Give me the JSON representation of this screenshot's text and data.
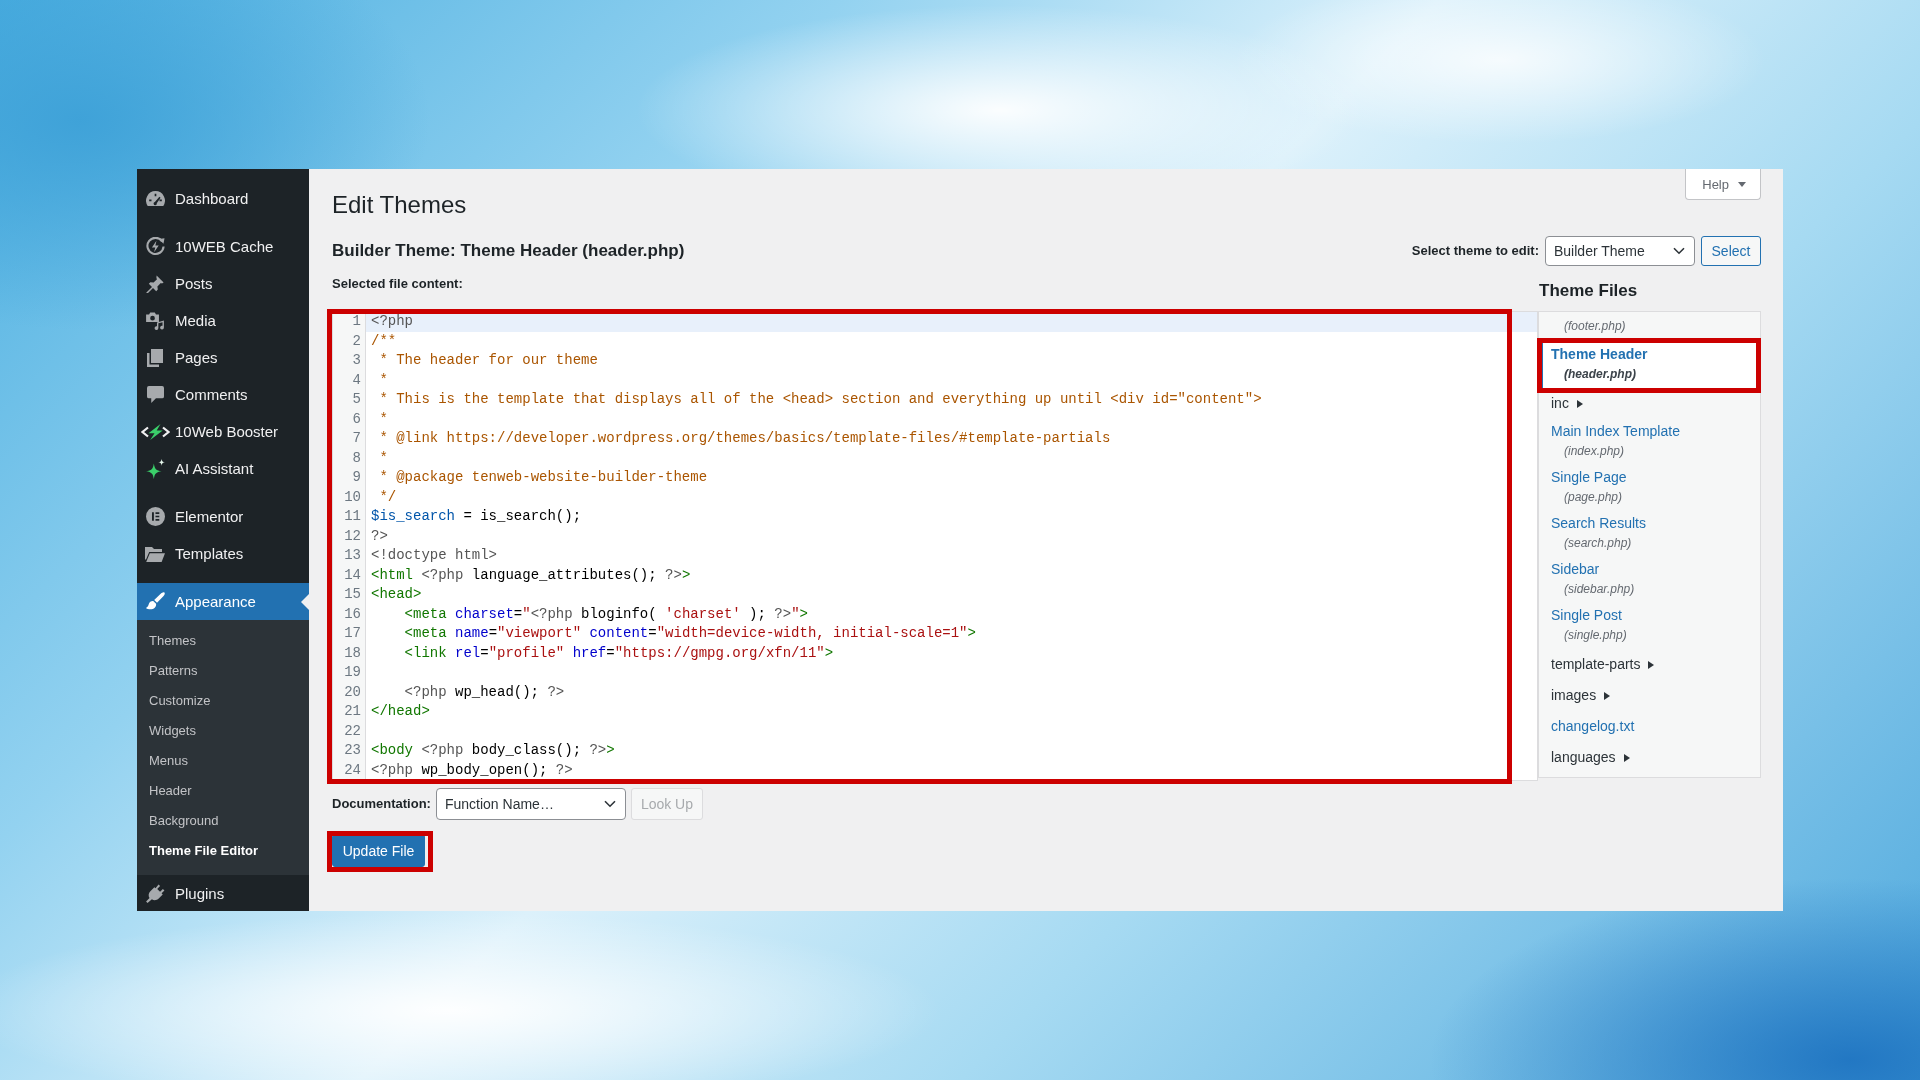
{
  "sidebar": {
    "groups": [
      {
        "items": [
          {
            "label": "Dashboard",
            "selected": false
          }
        ]
      },
      {
        "items": [
          {
            "label": "10WEB Cache",
            "selected": false
          },
          {
            "label": "Posts",
            "selected": false
          },
          {
            "label": "Media",
            "selected": false
          },
          {
            "label": "Pages",
            "selected": false
          },
          {
            "label": "Comments",
            "selected": false
          },
          {
            "label": "10Web Booster",
            "selected": false
          },
          {
            "label": "AI Assistant",
            "selected": false
          }
        ]
      },
      {
        "items": [
          {
            "label": "Elementor",
            "selected": false
          },
          {
            "label": "Templates",
            "selected": false
          }
        ]
      },
      {
        "items": [
          {
            "label": "Appearance",
            "selected": true,
            "children": [
              {
                "label": "Themes",
                "selected": false
              },
              {
                "label": "Patterns",
                "selected": false
              },
              {
                "label": "Customize",
                "selected": false
              },
              {
                "label": "Widgets",
                "selected": false
              },
              {
                "label": "Menus",
                "selected": false
              },
              {
                "label": "Header",
                "selected": false
              },
              {
                "label": "Background",
                "selected": false
              },
              {
                "label": "Theme File Editor",
                "selected": true
              }
            ]
          },
          {
            "label": "Plugins",
            "selected": false
          }
        ]
      }
    ]
  },
  "title": "Edit Themes",
  "help_button": {
    "label": "Help"
  },
  "file_title": "Builder Theme: Theme Header (header.php)",
  "theme_select": {
    "label": "Select theme to edit:",
    "value": "Builder Theme",
    "button": "Select"
  },
  "editor": {
    "label": "Selected file content:",
    "outlined": true,
    "lines": [
      {
        "number": "1",
        "active": true,
        "tokens": [
          {
            "kind": "meta",
            "text": "<?php"
          }
        ]
      },
      {
        "number": "2",
        "active": false,
        "tokens": [
          {
            "kind": "comment",
            "text": "/**"
          }
        ]
      },
      {
        "number": "3",
        "active": false,
        "tokens": [
          {
            "kind": "comment",
            "text": " * The header for our theme"
          }
        ]
      },
      {
        "number": "4",
        "active": false,
        "tokens": [
          {
            "kind": "comment",
            "text": " *"
          }
        ]
      },
      {
        "number": "5",
        "active": false,
        "tokens": [
          {
            "kind": "comment",
            "text": " * This is the template that displays all of the <head> section and everything up until <div id=\"content\">"
          }
        ]
      },
      {
        "number": "6",
        "active": false,
        "tokens": [
          {
            "kind": "comment",
            "text": " *"
          }
        ]
      },
      {
        "number": "7",
        "active": false,
        "tokens": [
          {
            "kind": "comment",
            "text": " * @link https://developer.wordpress.org/themes/basics/template-files/#template-partials"
          }
        ]
      },
      {
        "number": "8",
        "active": false,
        "tokens": [
          {
            "kind": "comment",
            "text": " *"
          }
        ]
      },
      {
        "number": "9",
        "active": false,
        "tokens": [
          {
            "kind": "comment",
            "text": " * @package tenweb-website-builder-theme"
          }
        ]
      },
      {
        "number": "10",
        "active": false,
        "tokens": [
          {
            "kind": "comment",
            "text": " */"
          }
        ]
      },
      {
        "number": "11",
        "active": false,
        "tokens": [
          {
            "kind": "variable",
            "text": "$is_search"
          },
          {
            "kind": "plain",
            "text": " = is_search();"
          }
        ]
      },
      {
        "number": "12",
        "active": false,
        "tokens": [
          {
            "kind": "meta",
            "text": "?>"
          }
        ]
      },
      {
        "number": "13",
        "active": false,
        "tokens": [
          {
            "kind": "meta",
            "text": "<!doctype html>"
          }
        ]
      },
      {
        "number": "14",
        "active": false,
        "tokens": [
          {
            "kind": "tag",
            "text": "<html"
          },
          {
            "kind": "meta",
            "text": " <?php"
          },
          {
            "kind": "plain",
            "text": " language_attributes(); "
          },
          {
            "kind": "meta",
            "text": "?>"
          },
          {
            "kind": "tag",
            "text": ">"
          }
        ]
      },
      {
        "number": "15",
        "active": false,
        "tokens": [
          {
            "kind": "tag",
            "text": "<head>"
          }
        ]
      },
      {
        "number": "16",
        "active": false,
        "indent": true,
        "tokens": [
          {
            "kind": "tag",
            "text": "<meta"
          },
          {
            "kind": "attribute",
            "text": " charset"
          },
          {
            "kind": "plain",
            "text": "="
          },
          {
            "kind": "string",
            "text": "\""
          },
          {
            "kind": "meta",
            "text": "<?php"
          },
          {
            "kind": "plain",
            "text": " bloginfo( "
          },
          {
            "kind": "string",
            "text": "'charset'"
          },
          {
            "kind": "plain",
            "text": " ); "
          },
          {
            "kind": "meta",
            "text": "?>"
          },
          {
            "kind": "string",
            "text": "\""
          },
          {
            "kind": "tag",
            "text": ">"
          }
        ]
      },
      {
        "number": "17",
        "active": false,
        "indent": true,
        "tokens": [
          {
            "kind": "tag",
            "text": "<meta"
          },
          {
            "kind": "attribute",
            "text": " name"
          },
          {
            "kind": "plain",
            "text": "="
          },
          {
            "kind": "string",
            "text": "\"viewport\""
          },
          {
            "kind": "attribute",
            "text": " content"
          },
          {
            "kind": "plain",
            "text": "="
          },
          {
            "kind": "string",
            "text": "\"width=device-width, initial-scale=1\""
          },
          {
            "kind": "tag",
            "text": ">"
          }
        ]
      },
      {
        "number": "18",
        "active": false,
        "indent": true,
        "tokens": [
          {
            "kind": "tag",
            "text": "<link"
          },
          {
            "kind": "attribute",
            "text": " rel"
          },
          {
            "kind": "plain",
            "text": "="
          },
          {
            "kind": "string",
            "text": "\"profile\""
          },
          {
            "kind": "attribute",
            "text": " href"
          },
          {
            "kind": "plain",
            "text": "="
          },
          {
            "kind": "string",
            "text": "\"https://gmpg.org/xfn/11\""
          },
          {
            "kind": "tag",
            "text": ">"
          }
        ]
      },
      {
        "number": "19",
        "active": false
      },
      {
        "number": "20",
        "active": false,
        "indent": true,
        "tokens": [
          {
            "kind": "meta",
            "text": "<?php"
          },
          {
            "kind": "plain",
            "text": " wp_head(); "
          },
          {
            "kind": "meta",
            "text": "?>"
          }
        ]
      },
      {
        "number": "21",
        "active": false,
        "tokens": [
          {
            "kind": "tag",
            "text": "</head>"
          }
        ]
      },
      {
        "number": "22",
        "active": false
      },
      {
        "number": "23",
        "active": false,
        "tokens": [
          {
            "kind": "tag",
            "text": "<body"
          },
          {
            "kind": "meta",
            "text": " <?php"
          },
          {
            "kind": "plain",
            "text": " body_class(); "
          },
          {
            "kind": "meta",
            "text": "?>"
          },
          {
            "kind": "tag",
            "text": ">"
          }
        ]
      },
      {
        "number": "24",
        "active": false,
        "tokens": [
          {
            "kind": "meta",
            "text": "<?php"
          },
          {
            "kind": "plain",
            "text": " wp_body_open(); "
          },
          {
            "kind": "meta",
            "text": "?>"
          }
        ]
      }
    ]
  },
  "documentation": {
    "label": "Documentation:",
    "value": "Function Name…",
    "button": {
      "label": "Look Up",
      "disabled": true
    }
  },
  "update_button": {
    "label": "Update File",
    "outlined": true
  },
  "theme_files": {
    "title": "Theme Files",
    "items": [
      {
        "kind": "file",
        "filename": "(footer.php)",
        "selected": false
      },
      {
        "kind": "file",
        "label": "Theme Header",
        "filename": "(header.php)",
        "selected": true,
        "outlined": true
      },
      {
        "kind": "folder",
        "label": "inc",
        "expanded": false,
        "selected": false
      },
      {
        "kind": "file",
        "label": "Main Index Template",
        "filename": "(index.php)",
        "selected": false
      },
      {
        "kind": "file",
        "label": "Single Page",
        "filename": "(page.php)",
        "selected": false
      },
      {
        "kind": "file",
        "label": "Search Results",
        "filename": "(search.php)",
        "selected": false
      },
      {
        "kind": "file",
        "label": "Sidebar",
        "filename": "(sidebar.php)",
        "selected": false
      },
      {
        "kind": "file",
        "label": "Single Post",
        "filename": "(single.php)",
        "selected": false
      },
      {
        "kind": "folder",
        "label": "template-parts",
        "expanded": false,
        "selected": false
      },
      {
        "kind": "folder",
        "label": "images",
        "expanded": false,
        "selected": false
      },
      {
        "kind": "file",
        "label": "changelog.txt",
        "selected": false
      },
      {
        "kind": "folder",
        "label": "languages",
        "expanded": false,
        "selected": false
      }
    ]
  }
}
